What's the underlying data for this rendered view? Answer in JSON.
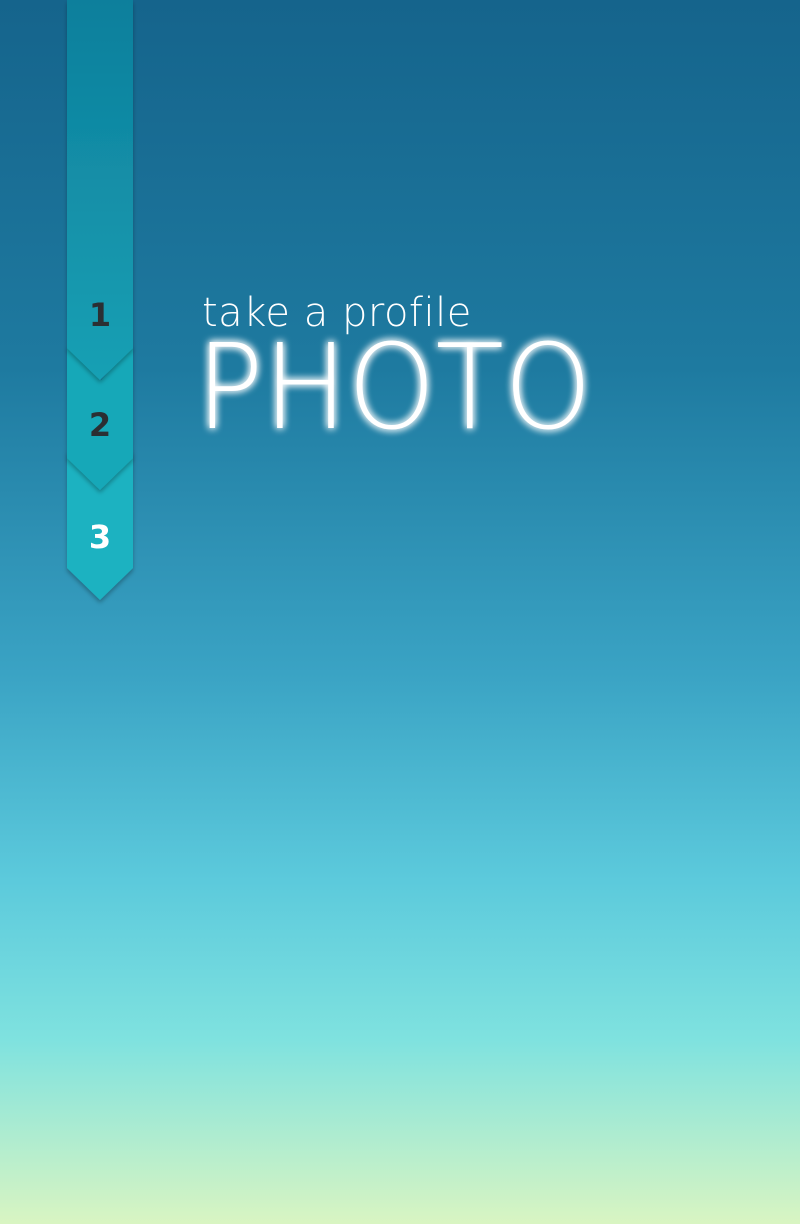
{
  "steps": [
    {
      "label": "1",
      "state": "completed"
    },
    {
      "label": "2",
      "state": "completed"
    },
    {
      "label": "3",
      "state": "current"
    }
  ],
  "headline": {
    "subtitle": "take a profile",
    "title": "PHOTO"
  },
  "colors": {
    "ribbon_dark": "#13889f",
    "ribbon_mid": "#17a1b2",
    "ribbon_light": "#1fb3c2",
    "step_text": "#2b2f33",
    "title_glow": "#ffffff"
  }
}
